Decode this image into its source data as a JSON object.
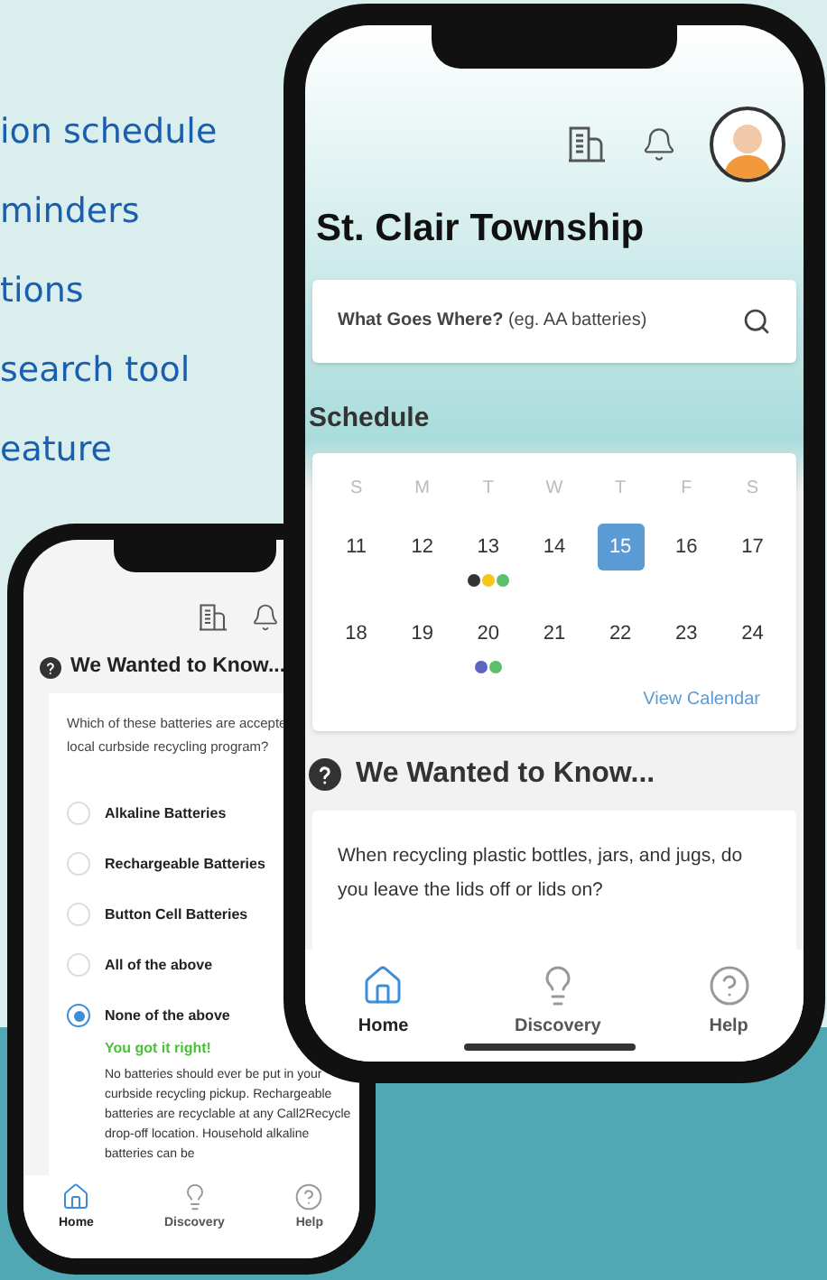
{
  "features": [
    "ion schedule",
    "minders",
    "tions",
    "search tool",
    "eature"
  ],
  "quiz_phone": {
    "title": "We Wanted to Know...",
    "question_lines": [
      "Which of these batteries are accepte",
      "local curbside recycling program?"
    ],
    "options": [
      {
        "label": "Alkaline Batteries",
        "selected": false
      },
      {
        "label": "Rechargeable Batteries",
        "selected": false
      },
      {
        "label": "Button Cell Batteries",
        "selected": false
      },
      {
        "label": "All of the above",
        "selected": false
      },
      {
        "label": "None of the above",
        "selected": true
      }
    ],
    "feedback_title": "You got it right!",
    "feedback": "No batteries should ever be put in your curbside recycling pickup. Rechargeable batteries are recyclable at any Call2Recycle drop-off location. Household alkaline batteries can be",
    "nav": [
      {
        "kind": "home",
        "label": "Home",
        "selected": true
      },
      {
        "kind": "discovery",
        "label": "Discovery",
        "selected": false
      },
      {
        "kind": "help",
        "label": "Help",
        "selected": false
      }
    ]
  },
  "main_phone": {
    "title": "St. Clair Township",
    "search": {
      "prompt": "**What Goes Where?** (eg. AA batteries)"
    },
    "schedule_title": "Schedule",
    "weekdays": [
      "S",
      "M",
      "T",
      "W",
      "T",
      "F",
      "S"
    ],
    "weeks": [
      [
        {
          "day": "11",
          "selected": false
        },
        {
          "day": "12",
          "selected": false
        },
        {
          "day": "13",
          "selected": false,
          "dots": [
            {
              "color": "#333333"
            },
            {
              "color": "#f5c518"
            },
            {
              "color": "#5cc06a"
            }
          ]
        },
        {
          "day": "14",
          "selected": false
        },
        {
          "day": "15",
          "selected": true
        },
        {
          "day": "16",
          "selected": false
        },
        {
          "day": "17",
          "selected": false
        }
      ],
      [
        {
          "day": "18",
          "selected": false
        },
        {
          "day": "19",
          "selected": false
        },
        {
          "day": "20",
          "selected": false,
          "dots": [
            {
              "color": "#5c64c0"
            },
            {
              "color": "#5cc06a"
            }
          ]
        },
        {
          "day": "21",
          "selected": false
        },
        {
          "day": "22",
          "selected": false
        },
        {
          "day": "23",
          "selected": false
        },
        {
          "day": "24",
          "selected": false
        }
      ]
    ],
    "link": "View Calendar",
    "quiz_title": "We Wanted to Know...",
    "quiz_question": "When recycling plastic bottles, jars, and jugs, do you leave the lids off or lids on?",
    "nav": [
      {
        "kind": "home",
        "label": "Home",
        "selected": true
      },
      {
        "kind": "discovery",
        "label": "Discovery",
        "selected": false
      },
      {
        "kind": "help",
        "label": "Help",
        "selected": false
      }
    ]
  }
}
